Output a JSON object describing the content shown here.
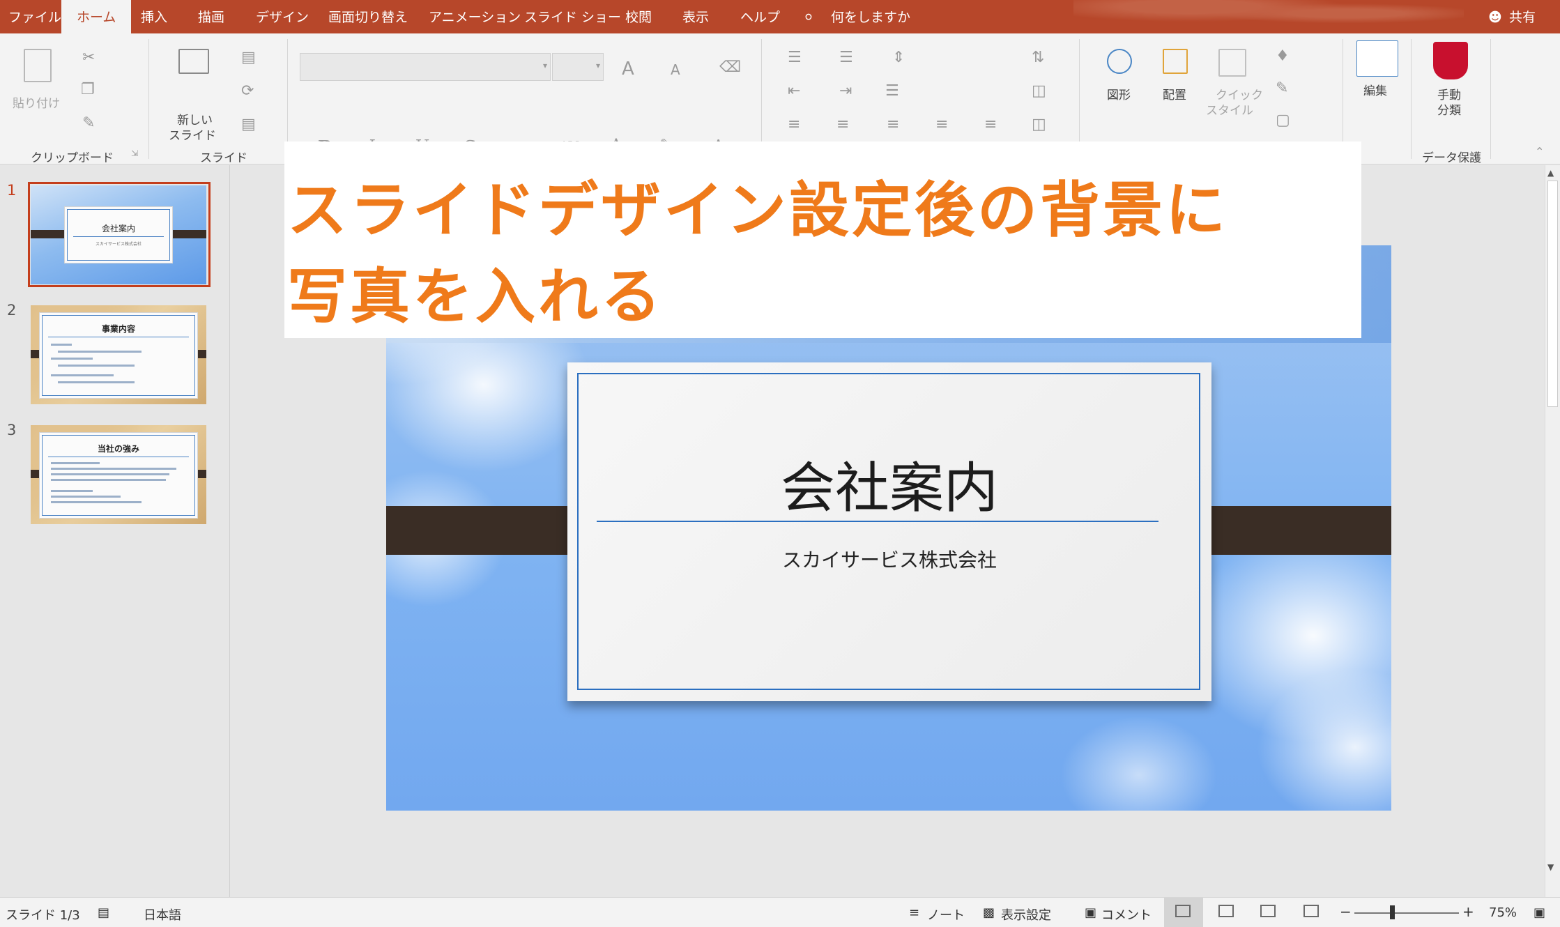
{
  "tabs": {
    "file": "ファイル",
    "home": "ホーム",
    "insert": "挿入",
    "draw": "描画",
    "design": "デザイン",
    "transitions": "画面切り替え",
    "animations": "アニメーション",
    "slideshow": "スライド ショー",
    "review": "校閲",
    "view": "表示",
    "help": "ヘルプ",
    "tell_me": "何をしますか",
    "share": "共有"
  },
  "ribbon": {
    "paste": "貼り付け",
    "clipboard_group": "クリップボード",
    "new_slide_line1": "新しい",
    "new_slide_line2": "スライド",
    "slides_group": "スライド",
    "shapes": "図形",
    "arrange": "配置",
    "quick_style_line1": "クイック",
    "quick_style_line2": "スタイル",
    "editing": "編集",
    "manual_line1": "手動",
    "manual_line2": "分類",
    "data_protection_group": "データ保護",
    "font_size_up": "A",
    "font_size_down": "A",
    "bold": "B",
    "italic": "I",
    "underline": "U",
    "shadow": "S",
    "strike": "abc",
    "spacing": "AV",
    "change_case": "Aa",
    "font_color": "A"
  },
  "thumbnails": [
    {
      "number": "1",
      "title": "会社案内",
      "subtitle": "スカイサービス株式会社"
    },
    {
      "number": "2",
      "title": "事業内容"
    },
    {
      "number": "3",
      "title": "当社の強み"
    }
  ],
  "slide": {
    "title": "会社案内",
    "subtitle": "スカイサービス株式会社"
  },
  "overlay": {
    "line1": "スライドデザイン設定後の背景に",
    "line2": "写真を入れる"
  },
  "status": {
    "slide_count": "スライド 1/3",
    "language": "日本語",
    "notes": "ノート",
    "display_settings": "表示設定",
    "comments": "コメント",
    "zoom_minus": "−",
    "zoom_plus": "+",
    "zoom": "75%"
  },
  "colors": {
    "accent": "#b7472a",
    "overlay_text": "#ef7a1a",
    "slide_rule": "#2b6fc0"
  }
}
